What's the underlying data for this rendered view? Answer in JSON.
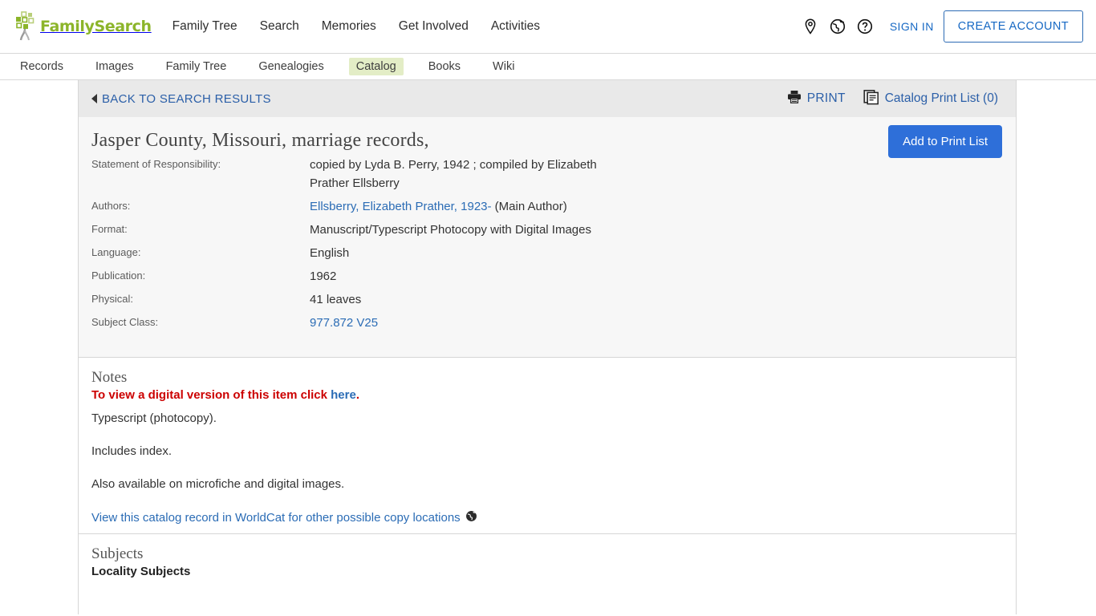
{
  "header": {
    "logo_text": "FamilySearch",
    "logo_icon": "family-tree-logo-icon",
    "nav": [
      {
        "label": "Family Tree"
      },
      {
        "label": "Search"
      },
      {
        "label": "Memories"
      },
      {
        "label": "Get Involved"
      },
      {
        "label": "Activities"
      }
    ],
    "icons": [
      {
        "name": "map-pin-icon"
      },
      {
        "name": "globe-icon"
      },
      {
        "name": "help-circle-icon"
      }
    ],
    "sign_in": "SIGN IN",
    "create_account": "CREATE ACCOUNT"
  },
  "subnav": {
    "items": [
      {
        "label": "Records",
        "active": false
      },
      {
        "label": "Images",
        "active": false
      },
      {
        "label": "Family Tree",
        "active": false
      },
      {
        "label": "Genealogies",
        "active": false
      },
      {
        "label": "Catalog",
        "active": true
      },
      {
        "label": "Books",
        "active": false
      },
      {
        "label": "Wiki",
        "active": false
      }
    ],
    "active_label": "Catalog"
  },
  "backbar": {
    "back_label": "BACK TO SEARCH RESULTS",
    "print_label": "PRINT",
    "print_list_label": "Catalog Print List (0)",
    "print_list_count": 0
  },
  "record": {
    "title": "Jasper County, Missouri, marriage records,",
    "add_button": "Add to Print List",
    "fields": [
      {
        "label": "Statement of Responsibility:",
        "value": "copied by Lyda B. Perry, 1942 ; compiled by Elizabeth Prather Ellsberry",
        "link": false
      },
      {
        "label": "Authors:",
        "value": "Ellsberry, Elizabeth Prather, 1923-",
        "suffix": " (Main Author)",
        "link": true
      },
      {
        "label": "Format:",
        "value": "Manuscript/Typescript Photocopy with Digital Images",
        "link": false
      },
      {
        "label": "Language:",
        "value": "English",
        "link": false
      },
      {
        "label": "Publication:",
        "value": "1962",
        "link": false
      },
      {
        "label": "Physical:",
        "value": "41 leaves",
        "link": false
      },
      {
        "label": "Subject Class:",
        "value": "977.872 V25",
        "link": true
      }
    ]
  },
  "notes": {
    "heading": "Notes",
    "alert_prefix": "To view a digital version of this item click ",
    "alert_link": "here",
    "alert_suffix": ".",
    "lines": [
      "Typescript (photocopy).",
      "Includes index.",
      "Also available on microfiche and digital images."
    ],
    "worldcat_link": "View this catalog record in WorldCat for other possible copy locations",
    "worldcat_icon": "globe-icon"
  },
  "subjects": {
    "heading": "Subjects",
    "locality_heading": "Locality Subjects"
  },
  "colors": {
    "brand_green": "#8cb52a",
    "link_blue": "#2b6cb5",
    "button_blue": "#2e6fd9",
    "alert_red": "#cc0000",
    "tab_active_bg": "#e3edc6",
    "panel_bg": "#f7f7f7",
    "backbar_bg": "#e9e9e9"
  }
}
